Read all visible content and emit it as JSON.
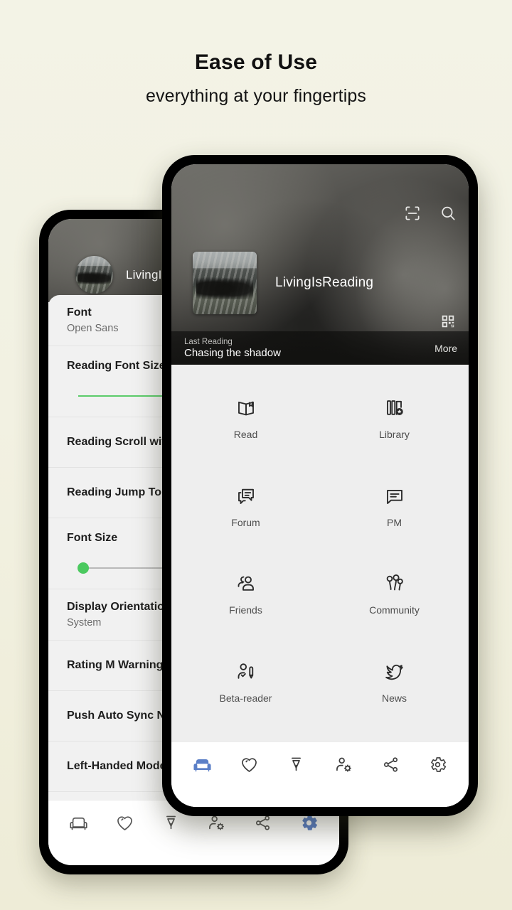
{
  "promo": {
    "title": "Ease of Use",
    "subtitle": "everything at your fingertips"
  },
  "colors": {
    "background_top": "#f3f3e6",
    "background_bottom": "#eeecd7",
    "accent_nav_active": "#5b7fc7",
    "slider_green": "#4bc95f",
    "screen_grey": "#eeeeee"
  },
  "front_phone": {
    "hero": {
      "account_name": "LivingIsReading",
      "scan_icon": "scan-icon",
      "search_icon": "search-icon",
      "qr_icon": "qr-code-icon",
      "avatar_icon": "account-avatar",
      "last_reading_label": "Last Reading",
      "last_reading_title": "Chasing the shadow",
      "more_label": "More"
    },
    "grid": [
      {
        "label": "Read",
        "icon": "open-book-icon"
      },
      {
        "label": "Library",
        "icon": "library-star-icon"
      },
      {
        "label": "Forum",
        "icon": "forum-chat-icon"
      },
      {
        "label": "PM",
        "icon": "message-bubble-icon"
      },
      {
        "label": "Friends",
        "icon": "friends-people-icon"
      },
      {
        "label": "Community",
        "icon": "community-balloons-icon"
      },
      {
        "label": "Beta-reader",
        "icon": "beta-reader-pen-icon"
      },
      {
        "label": "News",
        "icon": "news-bird-icon"
      }
    ],
    "bottom_nav": [
      {
        "name": "home",
        "icon": "armchair-icon",
        "active": true
      },
      {
        "name": "favorite",
        "icon": "heart-icon",
        "active": false
      },
      {
        "name": "write",
        "icon": "pen-nib-icon",
        "active": false
      },
      {
        "name": "account",
        "icon": "person-gear-icon",
        "active": false
      },
      {
        "name": "share",
        "icon": "share-nodes-icon",
        "active": false
      },
      {
        "name": "settings",
        "icon": "gear-icon",
        "active": false
      }
    ]
  },
  "back_phone": {
    "hero": {
      "account_name": "LivingIsReadin",
      "avatar_icon": "account-avatar-round"
    },
    "settings": [
      {
        "title": "Font",
        "subtitle": "Open Sans",
        "type": "value"
      },
      {
        "title": "Reading Font Size",
        "subtitle": "",
        "type": "slider",
        "fill_percent": 36,
        "thumb_percent": 36
      },
      {
        "title": "Reading Scroll with Vol",
        "subtitle": "",
        "type": "plain"
      },
      {
        "title": "Reading Jump To Featu",
        "subtitle": "",
        "type": "plain"
      },
      {
        "title": "Font Size",
        "subtitle": "",
        "type": "slider",
        "fill_percent": 2,
        "thumb_percent": 2
      },
      {
        "title": "Display Orientation",
        "subtitle": "System",
        "type": "value"
      },
      {
        "title": "Rating M Warning",
        "subtitle": "",
        "type": "plain"
      },
      {
        "title": "Push Auto Sync Notific",
        "subtitle": "",
        "type": "plain"
      },
      {
        "title": "Left-Handed Mode",
        "subtitle": "",
        "type": "plain"
      }
    ],
    "bottom_nav": [
      {
        "name": "home",
        "icon": "armchair-icon",
        "active": false
      },
      {
        "name": "favorite",
        "icon": "heart-icon",
        "active": false
      },
      {
        "name": "write",
        "icon": "pen-nib-icon",
        "active": false
      },
      {
        "name": "account",
        "icon": "person-gear-icon",
        "active": false
      },
      {
        "name": "share",
        "icon": "share-nodes-icon",
        "active": false
      },
      {
        "name": "settings",
        "icon": "gear-icon",
        "active": true
      }
    ]
  }
}
